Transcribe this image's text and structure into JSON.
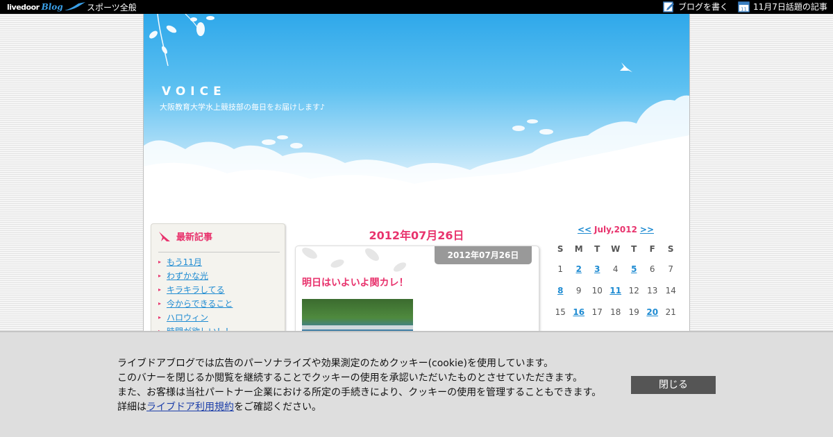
{
  "topbar": {
    "logo_text": "livedoor",
    "logo_blog": "Blog",
    "category": "スポーツ全般",
    "write_link": "ブログを書く",
    "topic_link": "11月7日話題の記事",
    "calendar_icon_day": "11"
  },
  "blog": {
    "title": "VOICE",
    "description": "大阪教育大学水上競技部の毎日をお届けします♪"
  },
  "sidebar": {
    "heading": "最新記事",
    "items": [
      {
        "label": "もう11月"
      },
      {
        "label": "わずかな光"
      },
      {
        "label": "キラキラしてる"
      },
      {
        "label": "今からできること"
      },
      {
        "label": "ハロウィン"
      },
      {
        "label": "時間が欲しい！！"
      }
    ]
  },
  "main": {
    "date_heading": "2012年07月26日",
    "entry": {
      "date": "2012年07月26日",
      "title": "明日はいよいよ関カレ！"
    }
  },
  "calendar": {
    "prev": "<<",
    "next": ">>",
    "month": "July,2012",
    "weekdays": [
      "S",
      "M",
      "T",
      "W",
      "T",
      "F",
      "S"
    ],
    "rows": [
      [
        {
          "d": "1",
          "link": false
        },
        {
          "d": "2",
          "link": true
        },
        {
          "d": "3",
          "link": true
        },
        {
          "d": "4",
          "link": false
        },
        {
          "d": "5",
          "link": true
        },
        {
          "d": "6",
          "link": false
        },
        {
          "d": "7",
          "link": false
        }
      ],
      [
        {
          "d": "8",
          "link": true
        },
        {
          "d": "9",
          "link": false
        },
        {
          "d": "10",
          "link": false
        },
        {
          "d": "11",
          "link": true
        },
        {
          "d": "12",
          "link": false
        },
        {
          "d": "13",
          "link": false
        },
        {
          "d": "14",
          "link": false
        }
      ],
      [
        {
          "d": "15",
          "link": false
        },
        {
          "d": "16",
          "link": true
        },
        {
          "d": "17",
          "link": false
        },
        {
          "d": "18",
          "link": false
        },
        {
          "d": "19",
          "link": false
        },
        {
          "d": "20",
          "link": true
        },
        {
          "d": "21",
          "link": false
        }
      ]
    ]
  },
  "cookie": {
    "line1": "ライブドアブログでは広告のパーソナライズや効果測定のためクッキー(cookie)を使用しています。",
    "line2": "このバナーを閉じるか閲覧を継続することでクッキーの使用を承認いただいたものとさせていただきます。",
    "line3": "また、お客様は当社パートナー企業における所定の手続きにより、クッキーの使用を管理することもできます。",
    "line4_prefix": "詳細は",
    "line4_link": "ライブドア利用規約",
    "line4_suffix": "をご確認ください。",
    "close_label": "閉じる"
  },
  "colors": {
    "accent_pink": "#e8336d",
    "link_blue": "#1e8bd2",
    "sky_blue": "#2fa8ea"
  }
}
